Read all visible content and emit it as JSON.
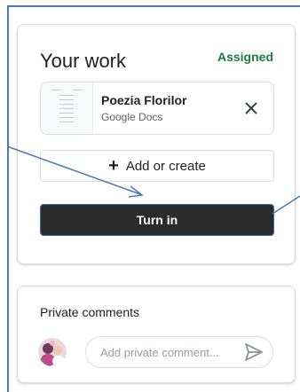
{
  "your_work": {
    "title": "Your work",
    "status": "Assigned",
    "attachment": {
      "name": "Poezia Florilor",
      "type": "Google Docs",
      "remove_icon": "close-icon"
    },
    "add_button": {
      "label": "Add or create",
      "icon": "plus-icon"
    },
    "turn_in_button": {
      "label": "Turn in"
    }
  },
  "private_comments": {
    "title": "Private comments",
    "input_placeholder": "Add private comment...",
    "send_icon": "send-icon",
    "avatar_icon": "avatar"
  },
  "colors": {
    "assigned_status": "#188038",
    "turn_in_bg": "#2b2b2b",
    "annotation_arrow": "#4a79b5",
    "border": "#dadce0"
  }
}
